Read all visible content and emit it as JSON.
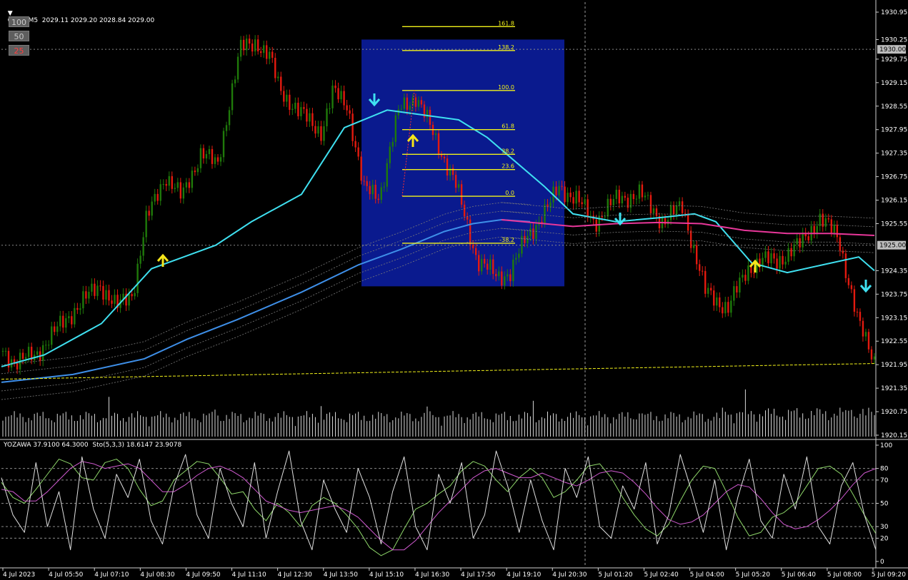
{
  "header": {
    "symbol_line": "GOLD,M5  2029.11 2029.20 2028.84 2029.00",
    "indicator_line": "YOZAWA 37.9100 64.3000  Sto(5,3,3) 18.6147 23.9078"
  },
  "level_buttons": [
    {
      "label": "100",
      "color": "#c8c8c8"
    },
    {
      "label": "50",
      "color": "#c8c8c8"
    },
    {
      "label": "25",
      "color": "#ff4040"
    }
  ],
  "colors": {
    "background": "#000000",
    "bull": "#1f7a0a",
    "bear": "#e31a0f",
    "fast_ma": "#3fe0f0",
    "slow_ma": "#3e8fe8",
    "envelope": "#7a7a7a",
    "pink_ma": "#e8379a",
    "fib_box": "#0a1a8e",
    "fib_line": "#f2f21a",
    "volume": "#d8d8d8",
    "volume_ma": "#f2f21a",
    "stoch_main": "#8fd86a",
    "stoch_signal": "#d05ad0",
    "yozawa": "#e0e0e0",
    "up_arrow": "#f5e51a",
    "down_arrow": "#3fe0f0"
  },
  "chart_data": [
    {
      "type": "candlestick",
      "title": "GOLD,M5",
      "price_axis": {
        "ticks": [
          "1930.95",
          "1930.25",
          "1929.75",
          "1929.15",
          "1928.55",
          "1927.95",
          "1927.35",
          "1926.75",
          "1926.15",
          "1925.55",
          "1924.35",
          "1923.75",
          "1923.15",
          "1922.55",
          "1921.95",
          "1921.35",
          "1920.75",
          "1920.15"
        ],
        "tick_values": [
          1930.95,
          1930.25,
          1929.75,
          1929.15,
          1928.55,
          1927.95,
          1927.35,
          1926.75,
          1926.15,
          1925.55,
          1924.35,
          1923.75,
          1923.15,
          1922.55,
          1921.95,
          1921.35,
          1920.75,
          1920.15
        ],
        "ylim": [
          1920.1,
          1931.2
        ],
        "markers": [
          {
            "label": "1930.00",
            "value": 1930.0
          },
          {
            "label": "1925.00",
            "value": 1925.0
          }
        ]
      },
      "time_axis": {
        "labels": [
          "4 Jul 2023",
          "4 Jul 05:50",
          "4 Jul 07:10",
          "4 Jul 08:30",
          "4 Jul 09:50",
          "4 Jul 11:10",
          "4 Jul 12:30",
          "4 Jul 13:50",
          "4 Jul 15:10",
          "4 Jul 16:30",
          "4 Jul 17:50",
          "4 Jul 19:10",
          "4 Jul 20:30",
          "5 Jul 01:20",
          "5 Jul 02:40",
          "5 Jul 04:00",
          "5 Jul 05:20",
          "5 Jul 06:40",
          "5 Jul 08:00",
          "5 Jul 09:20"
        ],
        "bar_count": 305
      },
      "price_path": [
        [
          0,
          1922.3
        ],
        [
          8,
          1922.0
        ],
        [
          20,
          1922.2
        ],
        [
          28,
          1922.6
        ],
        [
          45,
          1923.4
        ],
        [
          60,
          1924.0
        ],
        [
          70,
          1923.4
        ],
        [
          80,
          1923.8
        ],
        [
          88,
          1925.6
        ],
        [
          100,
          1926.8
        ],
        [
          110,
          1926.2
        ],
        [
          122,
          1927.4
        ],
        [
          132,
          1927.0
        ],
        [
          140,
          1928.8
        ],
        [
          146,
          1930.0
        ],
        [
          156,
          1930.2
        ],
        [
          164,
          1929.8
        ],
        [
          170,
          1929.0
        ],
        [
          182,
          1928.4
        ],
        [
          196,
          1927.9
        ],
        [
          203,
          1928.9
        ],
        [
          212,
          1928.6
        ],
        [
          222,
          1926.4
        ],
        [
          232,
          1926.3
        ],
        [
          244,
          1928.5
        ],
        [
          254,
          1928.8
        ],
        [
          264,
          1927.9
        ],
        [
          278,
          1926.6
        ],
        [
          292,
          1924.6
        ],
        [
          304,
          1924.2
        ],
        [
          312,
          1924.3
        ],
        [
          322,
          1925.2
        ],
        [
          336,
          1926.0
        ],
        [
          342,
          1926.5
        ],
        [
          352,
          1926.2
        ],
        [
          364,
          1925.6
        ],
        [
          378,
          1926.2
        ],
        [
          392,
          1926.3
        ],
        [
          406,
          1925.6
        ],
        [
          418,
          1926.0
        ],
        [
          432,
          1923.8
        ],
        [
          446,
          1923.4
        ],
        [
          458,
          1924.4
        ],
        [
          466,
          1924.6
        ],
        [
          476,
          1924.6
        ],
        [
          490,
          1925.0
        ],
        [
          502,
          1925.7
        ],
        [
          514,
          1925.2
        ],
        [
          526,
          1923.0
        ],
        [
          536,
          1922.1
        ]
      ],
      "series": [
        {
          "name": "fast_ma",
          "path": [
            [
              0,
              1921.9
            ],
            [
              60,
              1922.2
            ],
            [
              140,
              1923.0
            ],
            [
              210,
              1924.4
            ],
            [
              300,
              1925.0
            ],
            [
              350,
              1925.6
            ],
            [
              420,
              1926.3
            ],
            [
              480,
              1928.0
            ],
            [
              540,
              1928.45
            ],
            [
              600,
              1928.3
            ],
            [
              640,
              1928.2
            ],
            [
              680,
              1927.75
            ],
            [
              760,
              1926.5
            ],
            [
              800,
              1925.8
            ],
            [
              860,
              1925.6
            ],
            [
              920,
              1925.7
            ],
            [
              970,
              1925.8
            ],
            [
              1000,
              1925.6
            ],
            [
              1050,
              1924.55
            ],
            [
              1100,
              1924.3
            ],
            [
              1150,
              1924.5
            ],
            [
              1200,
              1924.7
            ],
            [
              1222,
              1924.35
            ]
          ]
        },
        {
          "name": "slow_ma",
          "path": [
            [
              0,
              1921.5
            ],
            [
              100,
              1921.7
            ],
            [
              200,
              1922.1
            ],
            [
              260,
              1922.6
            ],
            [
              330,
              1923.1
            ],
            [
              420,
              1923.8
            ],
            [
              500,
              1924.5
            ],
            [
              560,
              1924.9
            ],
            [
              620,
              1925.35
            ],
            [
              660,
              1925.55
            ],
            [
              700,
              1925.65
            ],
            [
              740,
              1925.6
            ]
          ]
        },
        {
          "name": "pink_ma",
          "path": [
            [
              700,
              1925.65
            ],
            [
              760,
              1925.55
            ],
            [
              800,
              1925.48
            ],
            [
              860,
              1925.55
            ],
            [
              920,
              1925.58
            ],
            [
              980,
              1925.55
            ],
            [
              1040,
              1925.38
            ],
            [
              1100,
              1925.3
            ],
            [
              1160,
              1925.3
            ],
            [
              1222,
              1925.25
            ]
          ]
        }
      ],
      "envelope_offset": 0.22,
      "volume_ma_line": {
        "start": 1921.58,
        "end": 1921.98
      },
      "signals": [
        {
          "type": "up",
          "bar": 228
        },
        {
          "type": "down",
          "bar": 524
        },
        {
          "type": "up",
          "bar": 578
        },
        {
          "type": "down",
          "bar": 868
        },
        {
          "type": "up",
          "bar": 1057
        },
        {
          "type": "down",
          "bar": 1212
        }
      ],
      "fibonacci": {
        "levels": [
          {
            "label": "161.8",
            "value": 1930.58
          },
          {
            "label": "138.2",
            "value": 1929.97
          },
          {
            "label": "100.0",
            "value": 1928.95
          },
          {
            "label": "61.8",
            "value": 1927.95
          },
          {
            "label": "38.2",
            "value": 1927.32
          },
          {
            "label": "23.6",
            "value": 1926.93
          },
          {
            "label": "0.0",
            "value": 1926.25
          },
          {
            "label": "-38.2",
            "value": 1925.05
          }
        ],
        "box": {
          "top": 1930.25,
          "bottom": 1923.95
        }
      }
    },
    {
      "type": "line",
      "title": "YOZAWA 37.9100 64.3000  Sto(5,3,3) 18.6147 23.9078",
      "ylim": [
        0,
        100
      ],
      "ticks": [
        "100",
        "80",
        "70",
        "50",
        "30",
        "20",
        "0"
      ],
      "tick_values": [
        100,
        80,
        70,
        50,
        30,
        20,
        0
      ],
      "dashed_levels": [
        80,
        70,
        50,
        30,
        20
      ],
      "series": [
        {
          "name": "stoch_main",
          "values": [
            68,
            55,
            50,
            62,
            75,
            88,
            84,
            72,
            70,
            85,
            88,
            80,
            62,
            48,
            52,
            70,
            78,
            86,
            84,
            72,
            58,
            60,
            45,
            35,
            50,
            42,
            30,
            48,
            55,
            50,
            40,
            28,
            12,
            5,
            10,
            28,
            45,
            50,
            58,
            65,
            78,
            86,
            82,
            70,
            60,
            72,
            80,
            72,
            55,
            60,
            70,
            82,
            84,
            72,
            55,
            40,
            28,
            22,
            32,
            52,
            70,
            82,
            80,
            60,
            38,
            22,
            25,
            38,
            42,
            50,
            65,
            80,
            82,
            75,
            58,
            40,
            24
          ]
        },
        {
          "name": "stoch_signal",
          "values": [
            62,
            60,
            52,
            52,
            60,
            70,
            80,
            86,
            84,
            80,
            82,
            84,
            80,
            70,
            60,
            60,
            66,
            74,
            80,
            82,
            78,
            72,
            62,
            52,
            48,
            44,
            42,
            44,
            46,
            48,
            44,
            38,
            28,
            18,
            10,
            10,
            18,
            30,
            42,
            52,
            62,
            72,
            78,
            80,
            76,
            72,
            72,
            76,
            72,
            68,
            65,
            70,
            76,
            78,
            76,
            68,
            58,
            46,
            36,
            32,
            34,
            40,
            50,
            60,
            66,
            64,
            54,
            42,
            32,
            28,
            30,
            36,
            44,
            54,
            66,
            76,
            80
          ]
        },
        {
          "name": "yozawa",
          "values": [
            72,
            40,
            25,
            85,
            30,
            60,
            10,
            90,
            45,
            20,
            75,
            55,
            88,
            35,
            15,
            65,
            92,
            40,
            20,
            80,
            50,
            30,
            85,
            20,
            60,
            95,
            35,
            10,
            70,
            45,
            25,
            80,
            55,
            15,
            60,
            90,
            30,
            10,
            75,
            50,
            85,
            20,
            40,
            95,
            65,
            25,
            70,
            35,
            10,
            80,
            55,
            90,
            30,
            20,
            65,
            45,
            85,
            15,
            40,
            92,
            60,
            25,
            70,
            10,
            55,
            88,
            35,
            20,
            75,
            45,
            90,
            30,
            15,
            65,
            85,
            40,
            10
          ]
        }
      ]
    }
  ]
}
